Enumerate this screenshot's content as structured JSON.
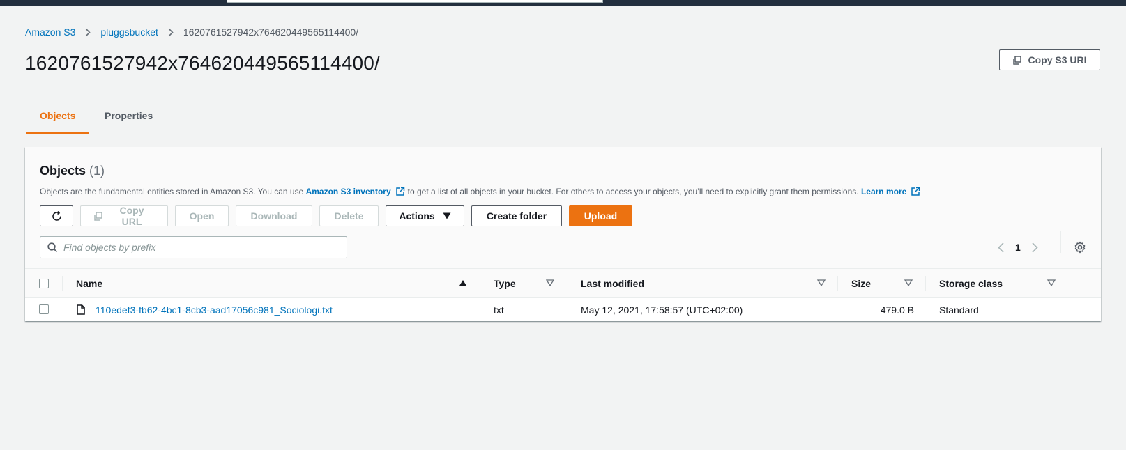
{
  "breadcrumb": {
    "items": [
      "Amazon S3",
      "pluggsbucket"
    ],
    "current": "1620761527942x764620449565114400/"
  },
  "page": {
    "title": "1620761527942x764620449565114400/",
    "copy_uri_label": "Copy S3 URI"
  },
  "tabs": [
    {
      "label": "Objects",
      "active": true
    },
    {
      "label": "Properties",
      "active": false
    }
  ],
  "objects_panel": {
    "title": "Objects",
    "count": "(1)",
    "desc_part1": "Objects are the fundamental entities stored in Amazon S3. You can use",
    "desc_link1": "Amazon S3 inventory",
    "desc_part2": "to get a list of all objects in your bucket. For others to access your objects, you’ll need to explicitly grant them permissions.",
    "desc_link2": "Learn more"
  },
  "toolbar": {
    "copy_url": "Copy URL",
    "open": "Open",
    "download": "Download",
    "delete": "Delete",
    "actions": "Actions",
    "create_folder": "Create folder",
    "upload": "Upload"
  },
  "search": {
    "placeholder": "Find objects by prefix"
  },
  "pagination": {
    "current_page": "1"
  },
  "table": {
    "columns": [
      "Name",
      "Type",
      "Last modified",
      "Size",
      "Storage class"
    ],
    "rows": [
      {
        "name": "110edef3-fb62-4bc1-8cb3-aad17056c981_Sociologi.txt",
        "type": "txt",
        "last_modified": "May 12, 2021, 17:58:57 (UTC+02:00)",
        "size": "479.0 B",
        "storage_class": "Standard"
      }
    ]
  },
  "colors": {
    "accent": "#ec7211",
    "link": "#0073bb",
    "topbar": "#232f3e",
    "background": "#f2f3f3"
  },
  "icons": [
    "chevron-right-icon",
    "copy-icon",
    "refresh-icon",
    "external-link-icon",
    "caret-down-icon",
    "search-icon",
    "chevron-left-icon",
    "settings-gear-icon",
    "sort-asc-icon",
    "sort-icon",
    "file-icon"
  ]
}
